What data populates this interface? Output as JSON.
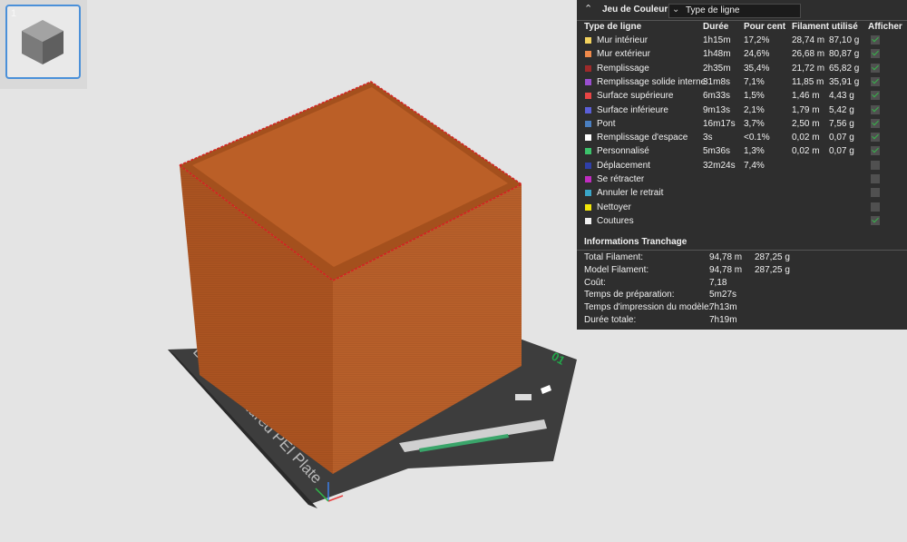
{
  "plate_thumbnail": {
    "index": "1"
  },
  "viewport": {
    "plate_label": "Bambu Textured PEI Plate",
    "plate_number": "01",
    "colors": {
      "background": "#e4e4e4",
      "model": "#b35a24",
      "plate": "#3f3f3f",
      "seam": "#d42222"
    }
  },
  "panel": {
    "title": "Jeu de Couleur",
    "view_select": "Type de ligne",
    "columns": {
      "type": "Type de ligne",
      "duration": "Durée",
      "percent": "Pour cent",
      "filament": "Filament utilisé",
      "show": "Afficher"
    },
    "rows": [
      {
        "color": "#f4d35e",
        "label": "Mur intérieur",
        "duration": "1h15m",
        "percent": "17,2%",
        "length": "28,74 m",
        "weight": "87,10 g",
        "show": true
      },
      {
        "color": "#f08a4b",
        "label": "Mur extérieur",
        "duration": "1h48m",
        "percent": "24,6%",
        "length": "26,68 m",
        "weight": "80,87 g",
        "show": true
      },
      {
        "color": "#9e2a2a",
        "label": "Remplissage",
        "duration": "2h35m",
        "percent": "35,4%",
        "length": "21,72 m",
        "weight": "65,82 g",
        "show": true
      },
      {
        "color": "#9a4fd0",
        "label": "Remplissage solide interne",
        "duration": "31m8s",
        "percent": "7,1%",
        "length": "11,85 m",
        "weight": "35,91 g",
        "show": true
      },
      {
        "color": "#e84545",
        "label": "Surface supérieure",
        "duration": "6m33s",
        "percent": "1,5%",
        "length": "1,46 m",
        "weight": "4,43 g",
        "show": true
      },
      {
        "color": "#5b5fd8",
        "label": "Surface inférieure",
        "duration": "9m13s",
        "percent": "2,1%",
        "length": "1,79 m",
        "weight": "5,42 g",
        "show": true
      },
      {
        "color": "#4a7fc1",
        "label": "Pont",
        "duration": "16m17s",
        "percent": "3,7%",
        "length": "2,50 m",
        "weight": "7,56 g",
        "show": true
      },
      {
        "color": "#ffffff",
        "label": "Remplissage d'espace",
        "duration": "3s",
        "percent": "<0.1%",
        "length": "0,02 m",
        "weight": "0,07 g",
        "show": true
      },
      {
        "color": "#3cc26b",
        "label": "Personnalisé",
        "duration": "5m36s",
        "percent": "1,3%",
        "length": "0,02 m",
        "weight": "0,07 g",
        "show": true
      },
      {
        "color": "#2f3fa8",
        "label": "Déplacement",
        "duration": "32m24s",
        "percent": "7,4%",
        "length": "",
        "weight": "",
        "show": false
      },
      {
        "color": "#c02cc0",
        "label": "Se rétracter",
        "duration": "",
        "percent": "",
        "length": "",
        "weight": "",
        "show": false
      },
      {
        "color": "#3aa6c9",
        "label": "Annuler le retrait",
        "duration": "",
        "percent": "",
        "length": "",
        "weight": "",
        "show": false
      },
      {
        "color": "#f2e60a",
        "label": "Nettoyer",
        "duration": "",
        "percent": "",
        "length": "",
        "weight": "",
        "show": false
      },
      {
        "color": "#f0f0f0",
        "label": "Coutures",
        "duration": "",
        "percent": "",
        "length": "",
        "weight": "",
        "show": true
      }
    ],
    "info_title": "Informations Tranchage",
    "info_rows": [
      {
        "label": "Total Filament:",
        "value1": "94,78 m",
        "value2": "287,25 g"
      },
      {
        "label": "Model Filament:",
        "value1": "94,78 m",
        "value2": "287,25 g"
      },
      {
        "label": "Coût:",
        "value1": "7,18",
        "value2": ""
      },
      {
        "label": "Temps de préparation:",
        "value1": "5m27s",
        "value2": ""
      },
      {
        "label": "Temps d'impression du modèle:",
        "value1": "7h13m",
        "value2": ""
      },
      {
        "label": "Durée totale:",
        "value1": "7h19m",
        "value2": ""
      }
    ]
  }
}
